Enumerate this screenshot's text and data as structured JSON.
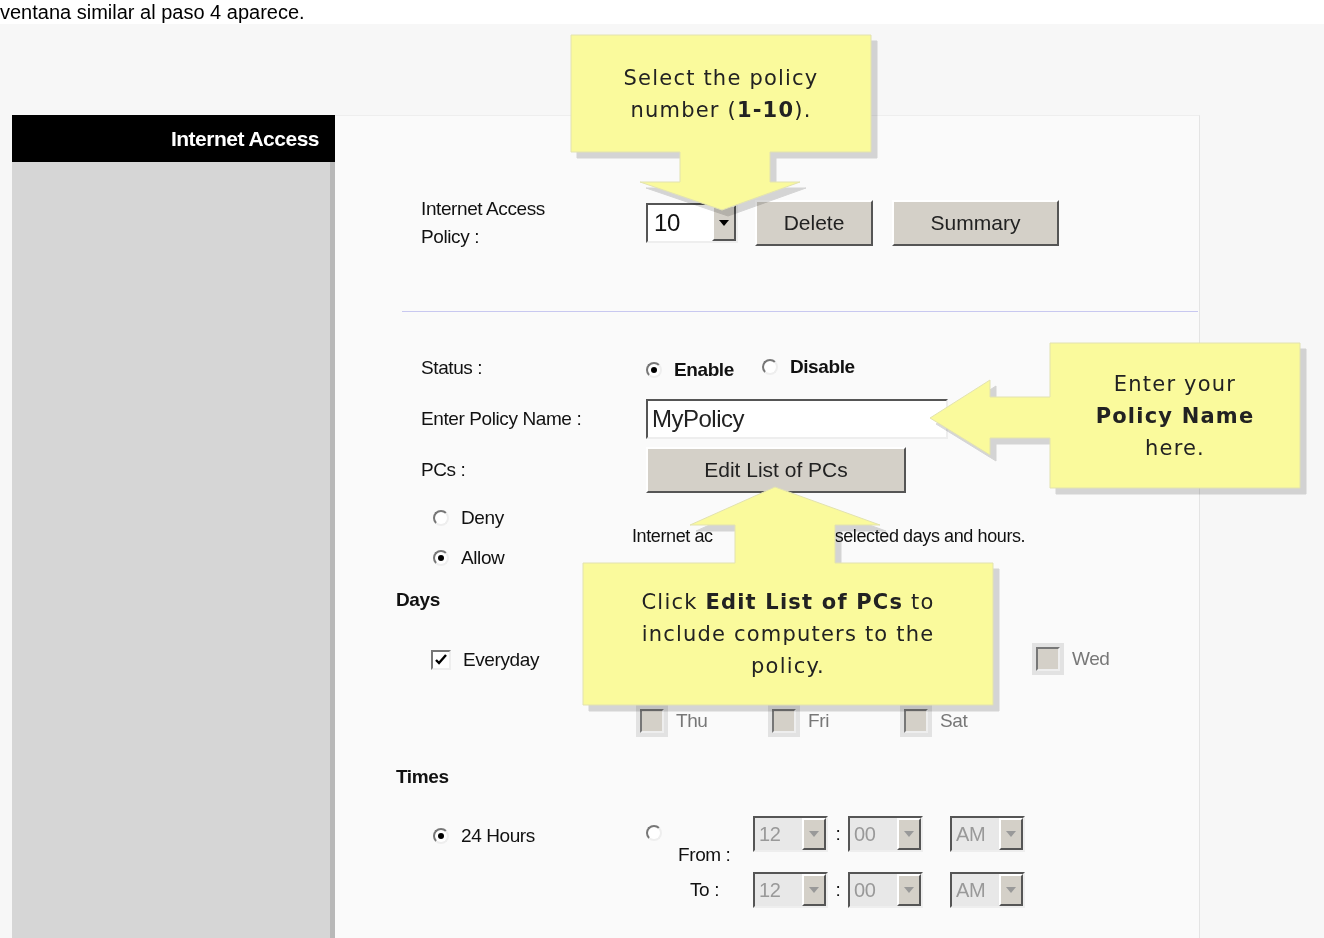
{
  "caption": "ventana similar al paso 4 aparece.",
  "sidebar": {
    "title": "Internet Access"
  },
  "policy": {
    "label": "Internet Access Policy :",
    "value": "10",
    "buttons": [
      "Delete",
      "Summary"
    ]
  },
  "status": {
    "label": "Status :",
    "options": [
      {
        "label": "Enable",
        "selected": true
      },
      {
        "label": "Disable",
        "selected": false
      }
    ]
  },
  "policy_name": {
    "label": "Enter Policy Name :",
    "value": "MyPolicy"
  },
  "pcs": {
    "label": "PCs :",
    "button": "Edit List of PCs"
  },
  "access": {
    "options": [
      {
        "label": "Deny",
        "selected": false
      },
      {
        "label": "Allow",
        "selected": true
      }
    ],
    "description_parts": [
      "Internet ac",
      "selected days and hours."
    ]
  },
  "days": {
    "title": "Days",
    "everyday": {
      "label": "Everyday",
      "checked": true
    },
    "weekdays": [
      {
        "label": "Wed",
        "checked": false,
        "disabled": true
      },
      {
        "label": "Thu",
        "checked": false,
        "disabled": true
      },
      {
        "label": "Fri",
        "checked": false,
        "disabled": true
      },
      {
        "label": "Sat",
        "checked": false,
        "disabled": true
      }
    ]
  },
  "times": {
    "title": "Times",
    "options": [
      {
        "label": "24 Hours",
        "selected": true
      },
      {
        "label": "From :",
        "selected": false
      }
    ],
    "fields_disabled": true,
    "separator": ":",
    "from": [
      "12",
      "00",
      "AM"
    ],
    "to_label": "To :",
    "to": [
      "12",
      "00",
      "AM"
    ]
  },
  "callouts": [
    {
      "kind": "down",
      "text": "Select the policy number (**1-10**)."
    },
    {
      "kind": "left",
      "text": "Enter your **Policy Name** here."
    },
    {
      "kind": "up",
      "text": "Click **Edit List of PCs** to include computers to the policy."
    }
  ]
}
